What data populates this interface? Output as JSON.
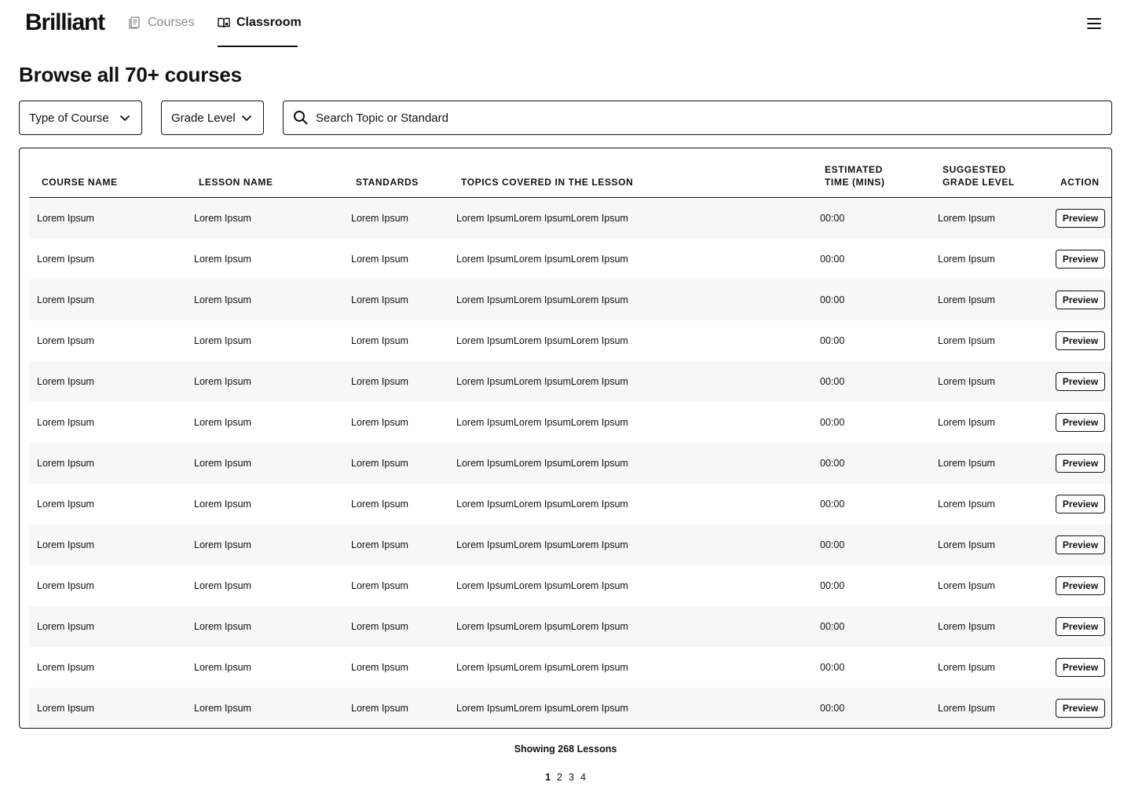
{
  "brand": {
    "logo": "Brilliant"
  },
  "nav": {
    "items": [
      {
        "label": "Courses",
        "icon": "courses-icon",
        "active": false
      },
      {
        "label": "Classroom",
        "icon": "classroom-icon",
        "active": true
      }
    ],
    "menu_icon": "hamburger-menu-icon"
  },
  "page": {
    "title": "Browse all 70+ courses"
  },
  "filters": {
    "type_of_course": "Type of Course",
    "grade_level": "Grade Level",
    "search_placeholder": "Search Topic or Standard"
  },
  "table": {
    "headers": {
      "course_name": "COURSE NAME",
      "lesson_name": "LESSON NAME",
      "standards": "STANDARDS",
      "topics": "TOPICS COVERED IN THE LESSON",
      "estimated_time_1": "ESTIMATED",
      "estimated_time_2": "TIME (MINS)",
      "suggested_grade_1": "SUGGESTED",
      "suggested_grade_2": "GRADE LEVEL",
      "action": "ACTION"
    },
    "rows": [
      {
        "course": "Lorem Ipsum",
        "lesson": "Lorem Ipsum",
        "standards": "Lorem Ipsum",
        "topics": "Lorem IpsumLorem IpsumLorem Ipsum",
        "time": "00:00",
        "grade": "Lorem Ipsum",
        "action": "Preview"
      },
      {
        "course": "Lorem Ipsum",
        "lesson": "Lorem Ipsum",
        "standards": "Lorem Ipsum",
        "topics": "Lorem IpsumLorem IpsumLorem Ipsum",
        "time": "00:00",
        "grade": "Lorem Ipsum",
        "action": "Preview"
      },
      {
        "course": "Lorem Ipsum",
        "lesson": "Lorem Ipsum",
        "standards": "Lorem Ipsum",
        "topics": "Lorem IpsumLorem IpsumLorem Ipsum",
        "time": "00:00",
        "grade": "Lorem Ipsum",
        "action": "Preview"
      },
      {
        "course": "Lorem Ipsum",
        "lesson": "Lorem Ipsum",
        "standards": "Lorem Ipsum",
        "topics": "Lorem IpsumLorem IpsumLorem Ipsum",
        "time": "00:00",
        "grade": "Lorem Ipsum",
        "action": "Preview"
      },
      {
        "course": "Lorem Ipsum",
        "lesson": "Lorem Ipsum",
        "standards": "Lorem Ipsum",
        "topics": "Lorem IpsumLorem IpsumLorem Ipsum",
        "time": "00:00",
        "grade": "Lorem Ipsum",
        "action": "Preview"
      },
      {
        "course": "Lorem Ipsum",
        "lesson": "Lorem Ipsum",
        "standards": "Lorem Ipsum",
        "topics": "Lorem IpsumLorem IpsumLorem Ipsum",
        "time": "00:00",
        "grade": "Lorem Ipsum",
        "action": "Preview"
      },
      {
        "course": "Lorem Ipsum",
        "lesson": "Lorem Ipsum",
        "standards": "Lorem Ipsum",
        "topics": "Lorem IpsumLorem IpsumLorem Ipsum",
        "time": "00:00",
        "grade": "Lorem Ipsum",
        "action": "Preview"
      },
      {
        "course": "Lorem Ipsum",
        "lesson": "Lorem Ipsum",
        "standards": "Lorem Ipsum",
        "topics": "Lorem IpsumLorem IpsumLorem Ipsum",
        "time": "00:00",
        "grade": "Lorem Ipsum",
        "action": "Preview"
      },
      {
        "course": "Lorem Ipsum",
        "lesson": "Lorem Ipsum",
        "standards": "Lorem Ipsum",
        "topics": "Lorem IpsumLorem IpsumLorem Ipsum",
        "time": "00:00",
        "grade": "Lorem Ipsum",
        "action": "Preview"
      },
      {
        "course": "Lorem Ipsum",
        "lesson": "Lorem Ipsum",
        "standards": "Lorem Ipsum",
        "topics": "Lorem IpsumLorem IpsumLorem Ipsum",
        "time": "00:00",
        "grade": "Lorem Ipsum",
        "action": "Preview"
      },
      {
        "course": "Lorem Ipsum",
        "lesson": "Lorem Ipsum",
        "standards": "Lorem Ipsum",
        "topics": "Lorem IpsumLorem IpsumLorem Ipsum",
        "time": "00:00",
        "grade": "Lorem Ipsum",
        "action": "Preview"
      },
      {
        "course": "Lorem Ipsum",
        "lesson": "Lorem Ipsum",
        "standards": "Lorem Ipsum",
        "topics": "Lorem IpsumLorem IpsumLorem Ipsum",
        "time": "00:00",
        "grade": "Lorem Ipsum",
        "action": "Preview"
      },
      {
        "course": "Lorem Ipsum",
        "lesson": "Lorem Ipsum",
        "standards": "Lorem Ipsum",
        "topics": "Lorem IpsumLorem IpsumLorem Ipsum",
        "time": "00:00",
        "grade": "Lorem Ipsum",
        "action": "Preview"
      }
    ]
  },
  "footer": {
    "showing": "Showing 268 Lessons",
    "pages": [
      "1",
      "2",
      "3",
      "4"
    ],
    "current_page": "1"
  }
}
